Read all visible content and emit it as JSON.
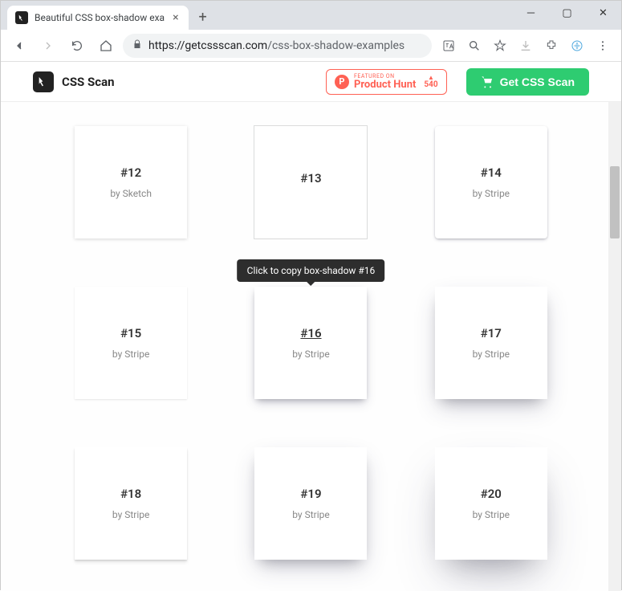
{
  "browser": {
    "tab_title": "Beautiful CSS box-shadow exa",
    "url_domain": "https://getcssscan.com",
    "url_path": "/css-box-shadow-examples"
  },
  "header": {
    "brand": "CSS Scan",
    "product_hunt": {
      "featured_label": "FEATURED ON",
      "name": "Product Hunt",
      "votes": "540"
    },
    "cta_label": "Get CSS Scan"
  },
  "tooltip_text": "Click to copy box-shadow #16",
  "cards": [
    {
      "num": "#12",
      "by": "by Sketch"
    },
    {
      "num": "#13",
      "by": ""
    },
    {
      "num": "#14",
      "by": "by Stripe"
    },
    {
      "num": "#15",
      "by": "by Stripe"
    },
    {
      "num": "#16",
      "by": "by Stripe"
    },
    {
      "num": "#17",
      "by": "by Stripe"
    },
    {
      "num": "#18",
      "by": "by Stripe"
    },
    {
      "num": "#19",
      "by": "by Stripe"
    },
    {
      "num": "#20",
      "by": "by Stripe"
    }
  ]
}
